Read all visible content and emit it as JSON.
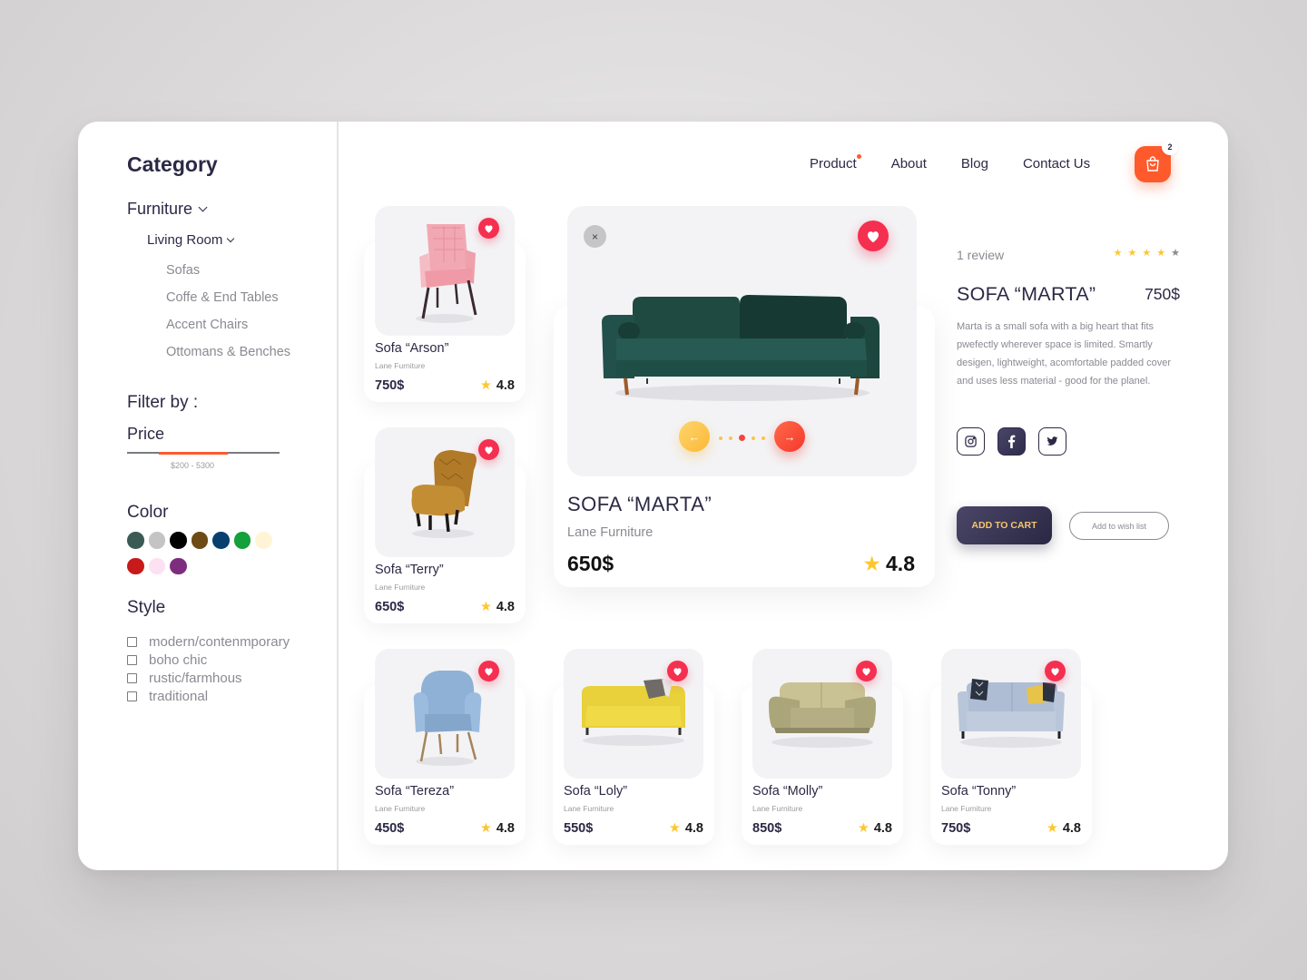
{
  "sidebar": {
    "category_title": "Category",
    "level1": "Furniture",
    "level2": "Living Room",
    "subcategories": [
      "Sofas",
      "Coffe & End Tables",
      "Accent Chairs",
      "Ottomans & Benches"
    ],
    "filter_title": "Filter by :",
    "price_label": "Price",
    "price_range_text": "$200 - 5300",
    "price_range_fill": {
      "start": 0.21,
      "end": 0.66
    },
    "color_title": "Color",
    "colors": [
      "#3b5a54",
      "#c4c4c4",
      "#000000",
      "#6e4a14",
      "#083f6e",
      "#14a03a",
      "#fff5d6",
      "#c81a1a",
      "#fde0f2",
      "#7e2d7e"
    ],
    "style_title": "Style",
    "styles": [
      "modern/contenmporary",
      "boho chic",
      "rustic/farmhous",
      "traditional"
    ]
  },
  "nav": {
    "links": [
      "Product",
      "About",
      "Blog",
      "Contact Us"
    ],
    "active": "Product",
    "cart_count": "2",
    "accent": "#ff5a2c"
  },
  "products": [
    {
      "name": "Sofa “Arson”",
      "brand": "Lane Furniture",
      "price": "750$",
      "rating": "4.8",
      "image": "pink-armchair"
    },
    {
      "name": "Sofa “Terry”",
      "brand": "Lane Furniture",
      "price": "650$",
      "rating": "4.8",
      "image": "mustard-slipper-chair"
    },
    {
      "name": "Sofa “Tereza”",
      "brand": "Lane Furniture",
      "price": "450$",
      "rating": "4.8",
      "image": "blue-armchair"
    },
    {
      "name": "Sofa “Loly”",
      "brand": "Lane Furniture",
      "price": "550$",
      "rating": "4.8",
      "image": "yellow-sofa"
    },
    {
      "name": "Sofa “Molly”",
      "brand": "Lane Furniture",
      "price": "850$",
      "rating": "4.8",
      "image": "beige-leather-sofa"
    },
    {
      "name": "Sofa “Tonny”",
      "brand": "Lane Furniture",
      "price": "750$",
      "rating": "4.8",
      "image": "grey-blue-sofa"
    }
  ],
  "featured": {
    "name": "SOFA “MARTA”",
    "brand": "Lane Furniture",
    "price": "650$",
    "rating": "4.8",
    "image": "green-velvet-sofa",
    "close_icon": "×",
    "prev_icon": "←",
    "next_icon": "→",
    "slides": 5,
    "active_slide": 3
  },
  "details": {
    "review_count": "1 review",
    "stars": 4,
    "stars_max": 5,
    "name": "SOFA “MARTA”",
    "price": "750$",
    "description": "Marta is a small sofa with a big heart that fits pwefectly wherever space is limited. Smartly desigen, lightweight, acomfortable padded cover and uses less material - good for the planel.",
    "socials": [
      "instagram",
      "facebook",
      "twitter"
    ],
    "add_to_cart": "ADD TO CART",
    "add_to_wishlist": "Add to wish list"
  },
  "star_glyph": "★"
}
